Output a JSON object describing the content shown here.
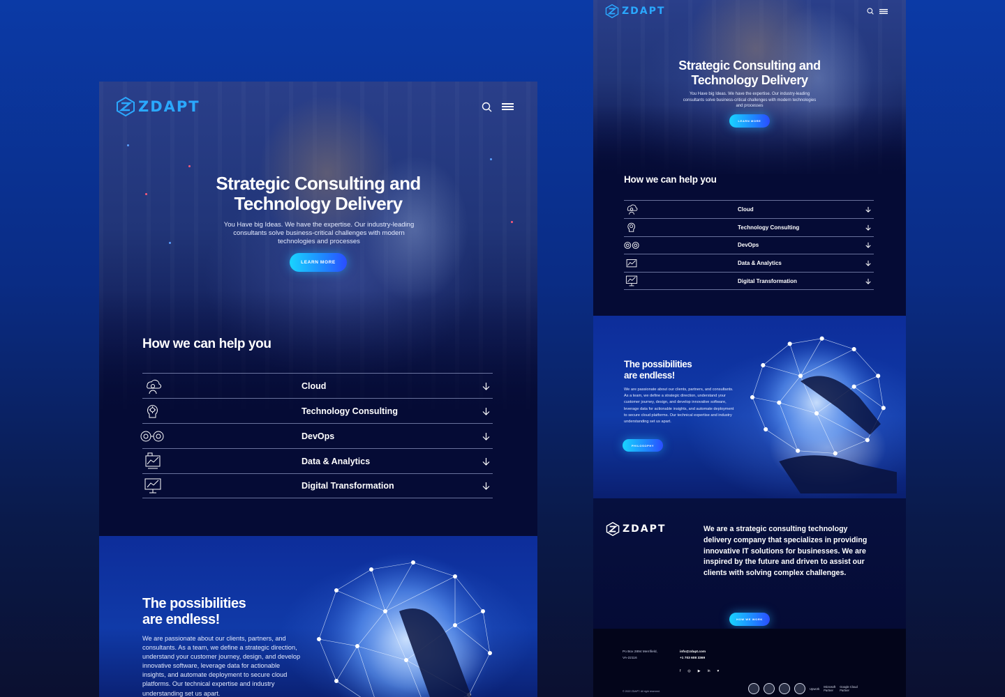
{
  "brand": {
    "name": "ZDAPT",
    "accent": "#2aa8ff",
    "cta_gradient": [
      "#19d4ff",
      "#2a4dff"
    ],
    "background": "#050b35"
  },
  "header": {
    "icons": [
      "search-icon",
      "menu-icon"
    ]
  },
  "hero": {
    "title_line1": "Strategic Consulting and",
    "title_line2": "Technology Delivery",
    "subtitle": "You Have big Ideas. We have the expertise. Our industry-leading consultants solve business-critical challenges with modern technologies and processes",
    "cta": "LEARN MORE"
  },
  "help": {
    "title": "How we can help you",
    "services": [
      {
        "label": "Cloud",
        "icon": "cloud-person-icon"
      },
      {
        "label": "Technology Consulting",
        "icon": "brain-gear-icon"
      },
      {
        "label": "DevOps",
        "icon": "devops-gears-icon"
      },
      {
        "label": "Data & Analytics",
        "icon": "analytics-chart-icon"
      },
      {
        "label": "Digital Transformation",
        "icon": "monitor-chart-icon"
      }
    ]
  },
  "possibilities": {
    "title_line1": "The possibilities",
    "title_line2": "are endless!",
    "body": "We are passionate about our clients, partners, and consultants. As a team, we define a strategic direction, understand your customer journey, design, and develop innovative software, leverage data for actionable insights, and automate deployment to secure cloud platforms. Our technical expertise and industry understanding set us apart.",
    "cta": "PHILOSOPHY"
  },
  "about": {
    "text": "We are a strategic consulting technology delivery company that specializes in providing innovative IT solutions for businesses. We are inspired by the future and driven to assist our clients with solving complex challenges.",
    "cta": "HOW WE WORK"
  },
  "footer": {
    "address_line1": "Po Box 2894 Merrifield,",
    "address_line2": "VA-22116",
    "email": "info@zdapt.com",
    "phone": "+1 703 608 3369",
    "social": [
      "facebook-icon",
      "instagram-icon",
      "youtube-icon",
      "linkedin-icon",
      "twitter-icon"
    ],
    "social_glyphs": [
      "f",
      "◎",
      "▶",
      "in",
      "♥"
    ],
    "copyright": "© 2022 ZDAPT. All right reserved.",
    "partner_upwork": "Upwork",
    "partner_microsoft_1": "Microsoft",
    "partner_microsoft_2": "Partner",
    "partner_google_1": "Google Cloud",
    "partner_google_2": "Partner"
  }
}
